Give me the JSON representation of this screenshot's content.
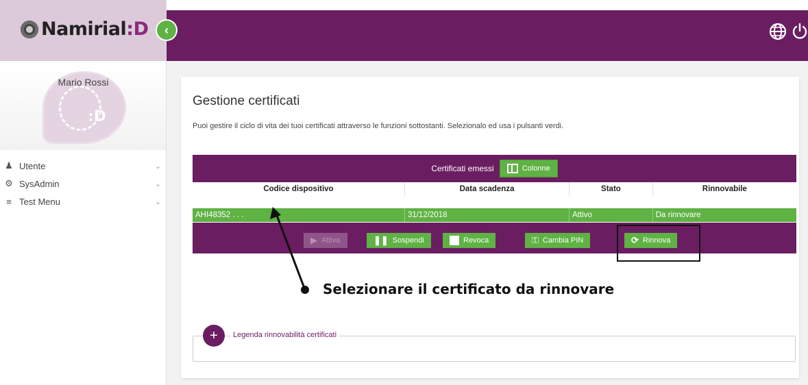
{
  "app": {
    "logo_text": "Namirial",
    "logo_suffix": "D"
  },
  "sidebar": {
    "user_name": "Mario Rossi",
    "items": [
      {
        "label": "Utente",
        "icon": "user-icon"
      },
      {
        "label": "SysAdmin",
        "icon": "gears-icon"
      },
      {
        "label": "Test Menu",
        "icon": "list-icon"
      }
    ]
  },
  "page": {
    "title": "Gestione certificati",
    "subtitle": "Puoi gestire il ciclo di vita dei tuoi certificati attraverso le funzioni sottostanti. Selezionalo ed usa i pulsanti verdi."
  },
  "table": {
    "caption": "Certificati emessi",
    "columns_button": "Colonne",
    "headers": [
      "Codice dispositivo",
      "Data scadenza",
      "Stato",
      "Rinnovabile"
    ],
    "rows": [
      [
        "AHI48352 . . .",
        "31/12/2018",
        "Attivo",
        "Da rinnovare"
      ]
    ]
  },
  "actions": {
    "attiva": "Attiva",
    "sospendi": "Sospendi",
    "revoca": "Revoca",
    "cambia_pin": "Cambia PIN",
    "rinnova": "Rinnova"
  },
  "annotation": "Selezionare il certificato da rinnovare",
  "legend": {
    "label": "Legenda rinnovabilità certificati"
  },
  "colors": {
    "brand_purple": "#6b1d62",
    "accent_green": "#5fb244",
    "sidebar_top": "#dcc9d9"
  }
}
